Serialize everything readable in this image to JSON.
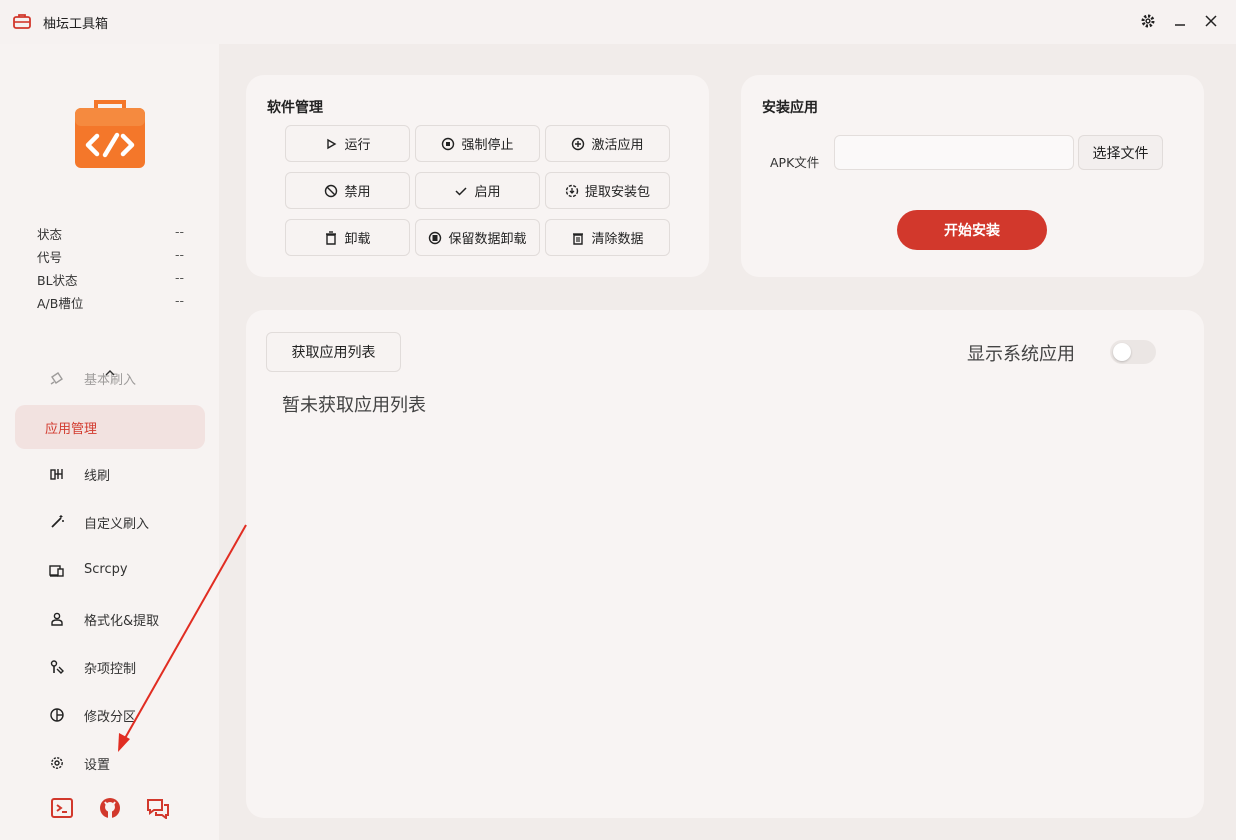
{
  "window": {
    "title": "柚坛工具箱",
    "controls": [
      "gear-icon",
      "minimize-icon",
      "close-icon"
    ]
  },
  "colors": {
    "accent": "#d2382c",
    "logo_orange": "#f4772a",
    "active_bg": "#f2e2e0"
  },
  "device_info": [
    {
      "label": "状态",
      "value": "--"
    },
    {
      "label": "代号",
      "value": "--"
    },
    {
      "label": "BL状态",
      "value": "--"
    },
    {
      "label": "A/B槽位",
      "value": "--"
    }
  ],
  "sidebar": {
    "items": [
      {
        "label": "基本刷入",
        "icon": "flash-icon"
      },
      {
        "label": "应用管理",
        "icon": ""
      },
      {
        "label": "线刷",
        "icon": "wire-flash-icon"
      },
      {
        "label": "自定义刷入",
        "icon": "wand-icon"
      },
      {
        "label": "Scrcpy",
        "icon": "screen-mirror-icon"
      },
      {
        "label": "格式化&提取",
        "icon": "format-icon"
      },
      {
        "label": "杂项控制",
        "icon": "tools-icon"
      },
      {
        "label": "修改分区",
        "icon": "partition-icon"
      },
      {
        "label": "设置",
        "icon": "settings-icon"
      }
    ],
    "active": "应用管理",
    "bottom_icons": [
      "terminal-icon",
      "github-icon",
      "chat-icon"
    ]
  },
  "software": {
    "title": "软件管理",
    "buttons": [
      {
        "label": "运行",
        "icon": "play-icon"
      },
      {
        "label": "强制停止",
        "icon": "stop-circle-icon"
      },
      {
        "label": "激活应用",
        "icon": "plus-circle-icon"
      },
      {
        "label": "禁用",
        "icon": "block-icon"
      },
      {
        "label": "启用",
        "icon": "check-icon"
      },
      {
        "label": "提取安装包",
        "icon": "extract-icon"
      },
      {
        "label": "卸载",
        "icon": "trash-icon"
      },
      {
        "label": "保留数据卸载",
        "icon": "keep-data-icon"
      },
      {
        "label": "清除数据",
        "icon": "clear-icon"
      }
    ]
  },
  "install": {
    "title": "安装应用",
    "apk_label": "APK文件",
    "apk_value": "",
    "choose_label": "选择文件",
    "start_label": "开始安装"
  },
  "app_list": {
    "fetch_label": "获取应用列表",
    "show_system_label": "显示系统应用",
    "show_system_on": false,
    "empty_text": "暂未获取应用列表"
  }
}
